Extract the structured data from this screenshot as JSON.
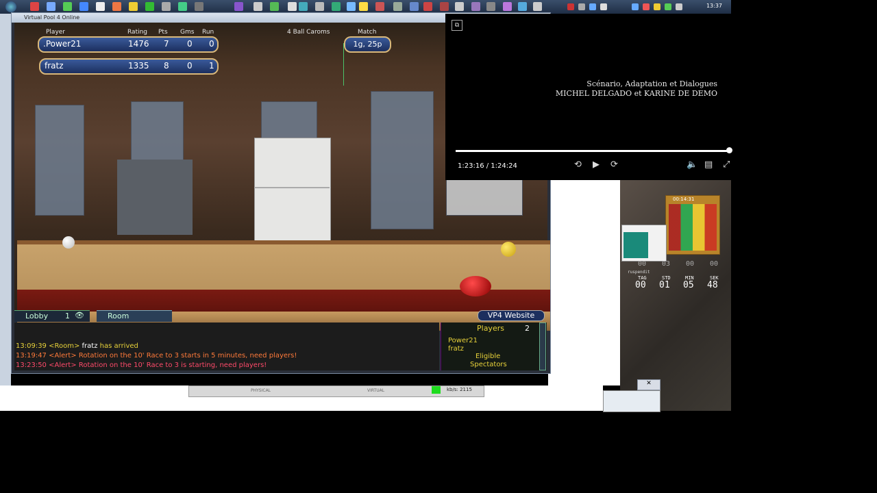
{
  "taskbar": {
    "clock": "13:37"
  },
  "game": {
    "window_title": "Virtual Pool 4 Online",
    "game_type": "4 Ball Caroms",
    "headers": {
      "player": "Player",
      "rating": "Rating",
      "pts": "Pts",
      "gms": "Gms",
      "run": "Run",
      "match": "Match"
    },
    "players": [
      {
        "name": ".Power21",
        "rating": "1476",
        "pts": "7",
        "gms": "0",
        "run": "0"
      },
      {
        "name": "fratz",
        "rating": "1335",
        "pts": "8",
        "gms": "0",
        "run": "1"
      }
    ],
    "match_value": "1g, 25p",
    "tabs": {
      "lobby": "Lobby",
      "lobby_count": "1",
      "room": "Room"
    },
    "website_button": "VP4 Website",
    "chat": [
      {
        "time": "13:09:39",
        "tag": "<Room>",
        "user": "fratz",
        "text": "has arrived",
        "color": "#e8d23a"
      },
      {
        "time": "13:19:47",
        "tag": "<Alert>",
        "text": "Rotation on the 10' Race to 3 starts in 5 minutes, need players!",
        "color": "#ff7a3a"
      },
      {
        "time": "13:23:50",
        "tag": "<Alert>",
        "text": "Rotation on the 10' Race to 3 is starting, need players!",
        "color": "#ff4a6a"
      }
    ],
    "players_panel": {
      "title": "Players",
      "count": "2",
      "list": [
        "Power21",
        "fratz"
      ],
      "eligible": "Eligible",
      "spectators": "Spectators"
    }
  },
  "video": {
    "credit_line1": "Scénario, Adaptation et Dialogues",
    "credit_line2": "MICHEL DELGADO et KARINE DE DEMO",
    "time": "1:23:16 / 1:24:24"
  },
  "timer": {
    "top_values": [
      "00",
      "03",
      "00",
      "00"
    ],
    "labels": [
      "TAG",
      "STD",
      "MIN",
      "SEK"
    ],
    "values": [
      "00",
      "01",
      "05",
      "48"
    ],
    "widget_time": "00:14:31",
    "caption": "ruspendit"
  },
  "status": {
    "physical": "PHYSICAL",
    "virtual": "VIRTUAL",
    "kbs": "kb/s: 2115"
  }
}
